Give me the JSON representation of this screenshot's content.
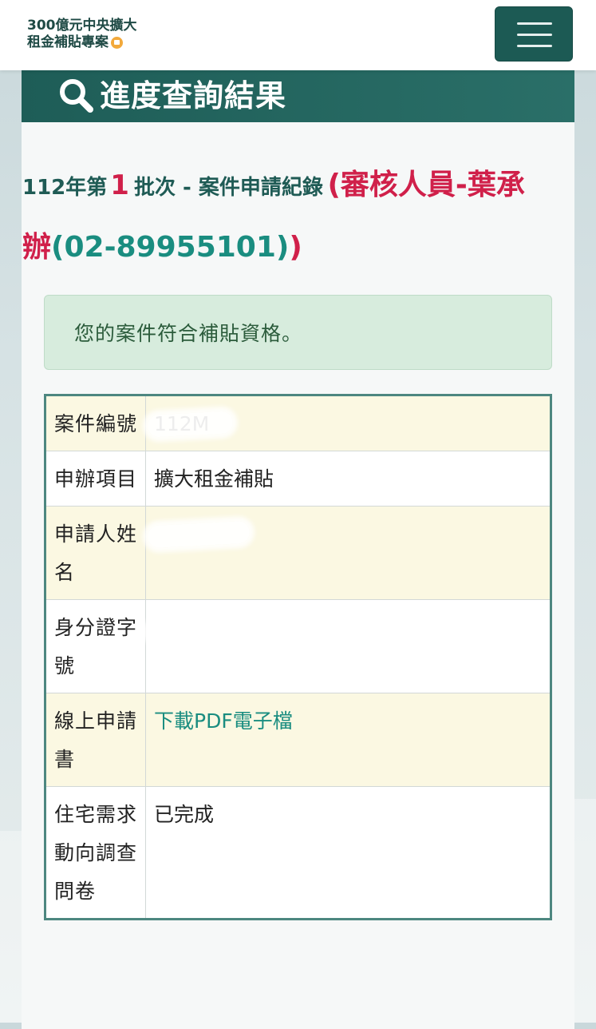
{
  "header": {
    "logo_line1": "300億元中央擴大",
    "logo_line2": "租金補貼專案"
  },
  "card": {
    "title": "進度查詢結果"
  },
  "batch": {
    "prefix": "112年第",
    "number": "1",
    "suffix": "批次 - 案件申請紀錄",
    "reviewer": "(審核人員-葉承辦",
    "phone": "(02-89955101)",
    "close": ")"
  },
  "alert": {
    "message": "您的案件符合補貼資格。"
  },
  "rows": [
    {
      "label": "案件編號",
      "value": "112M"
    },
    {
      "label": "申辦項目",
      "value": "擴大租金補貼"
    },
    {
      "label": "申請人姓名",
      "value": ""
    },
    {
      "label": "身分證字號",
      "value": ""
    },
    {
      "label": "線上申請書",
      "value": "下載PDF電子檔"
    },
    {
      "label": "住宅需求動向調查問卷",
      "value": "已完成"
    }
  ],
  "colors": {
    "brand": "#1c5a54",
    "accent_red": "#d0204a",
    "link_teal": "#1a8d80",
    "alert_bg": "#d7ecdd",
    "row_highlight": "#fbf8e2"
  }
}
